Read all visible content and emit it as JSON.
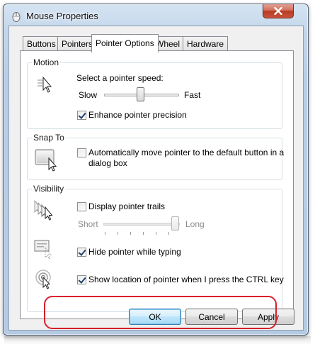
{
  "window": {
    "title": "Mouse Properties"
  },
  "tabs": [
    {
      "label": "Buttons",
      "active": false
    },
    {
      "label": "Pointers",
      "active": false
    },
    {
      "label": "Pointer Options",
      "active": true
    },
    {
      "label": "Wheel",
      "active": false
    },
    {
      "label": "Hardware",
      "active": false
    }
  ],
  "motion": {
    "group_title": "Motion",
    "speed_label": "Select a pointer speed:",
    "slow_label": "Slow",
    "fast_label": "Fast",
    "speed_level_fraction": 0.5,
    "enhance_label": "Enhance pointer precision",
    "enhance_checked": true
  },
  "snap": {
    "group_title": "Snap To",
    "label_line1": "Automatically move pointer to the default button in a",
    "label_line2": "dialog box",
    "checked": false
  },
  "visibility": {
    "group_title": "Visibility",
    "trails_label": "Display pointer trails",
    "trails_checked": false,
    "short_label": "Short",
    "long_label": "Long",
    "trails_level_fraction": 1.0,
    "hide_label": "Hide pointer while typing",
    "hide_checked": true,
    "show_location_label": "Show location of pointer when I press the CTRL key",
    "show_location_checked": true
  },
  "buttons": {
    "ok": "OK",
    "cancel": "Cancel",
    "apply": "Apply"
  },
  "colors": {
    "highlight": "#d81f2b",
    "default_button": "#3c7fb1",
    "close_button": "#c8533b"
  }
}
